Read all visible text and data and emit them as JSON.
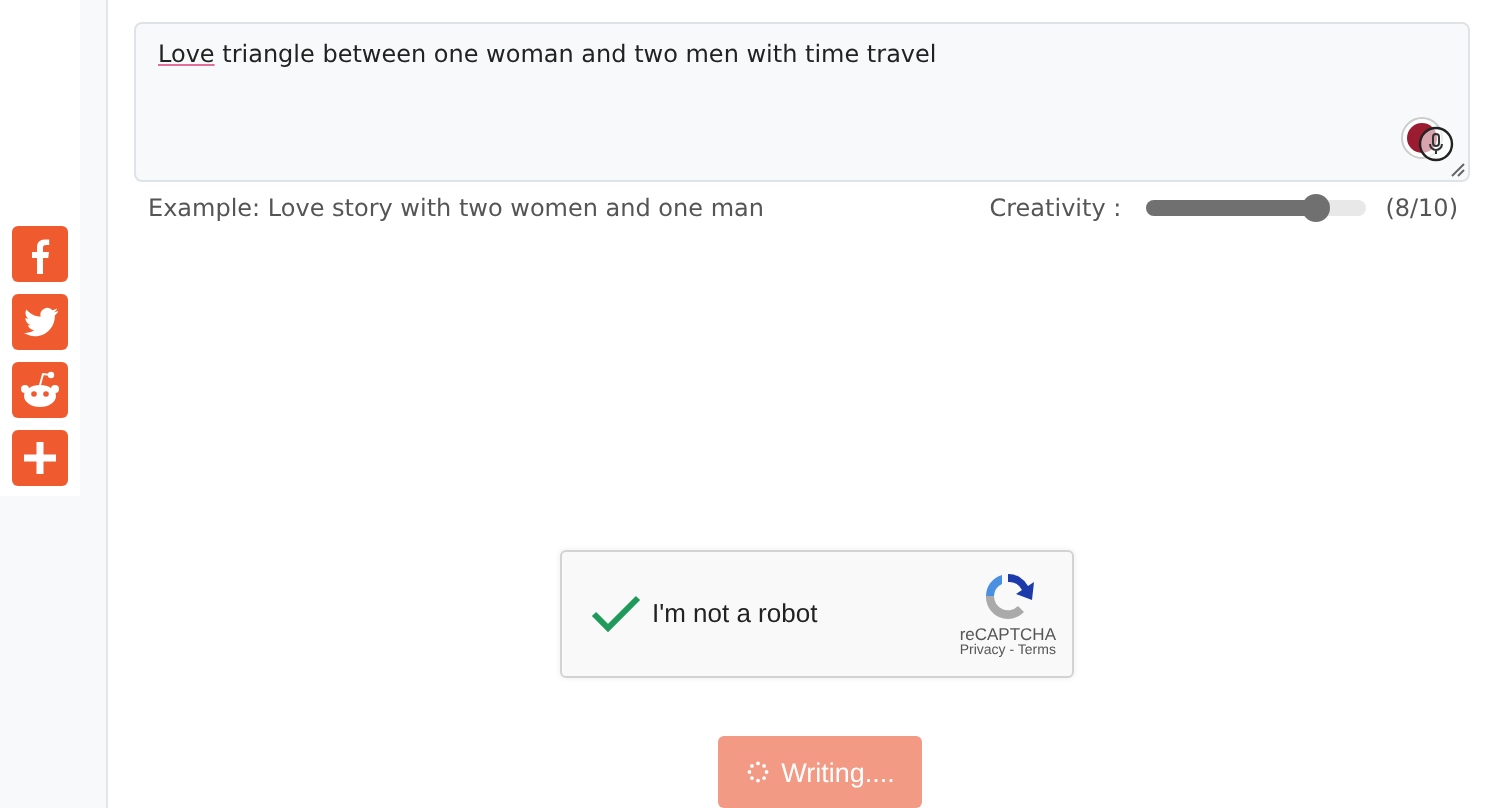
{
  "social": [
    {
      "kind": "facebook"
    },
    {
      "kind": "twitter"
    },
    {
      "kind": "reddit"
    },
    {
      "kind": "more"
    }
  ],
  "prompt": {
    "value": "Love triangle between one woman and two men with time travel"
  },
  "example": "Example: Love story with two women and one man",
  "creativity": {
    "label": "Creativity :",
    "level": 0.78,
    "reading": "(8/10)"
  },
  "captcha": {
    "checked": true,
    "label": "I'm not a robot",
    "brand": "reCAPTCHA",
    "privacy": "Privacy",
    "separator": "-",
    "terms": "Terms"
  },
  "submit": {
    "label": "Writing....",
    "loading": true
  }
}
